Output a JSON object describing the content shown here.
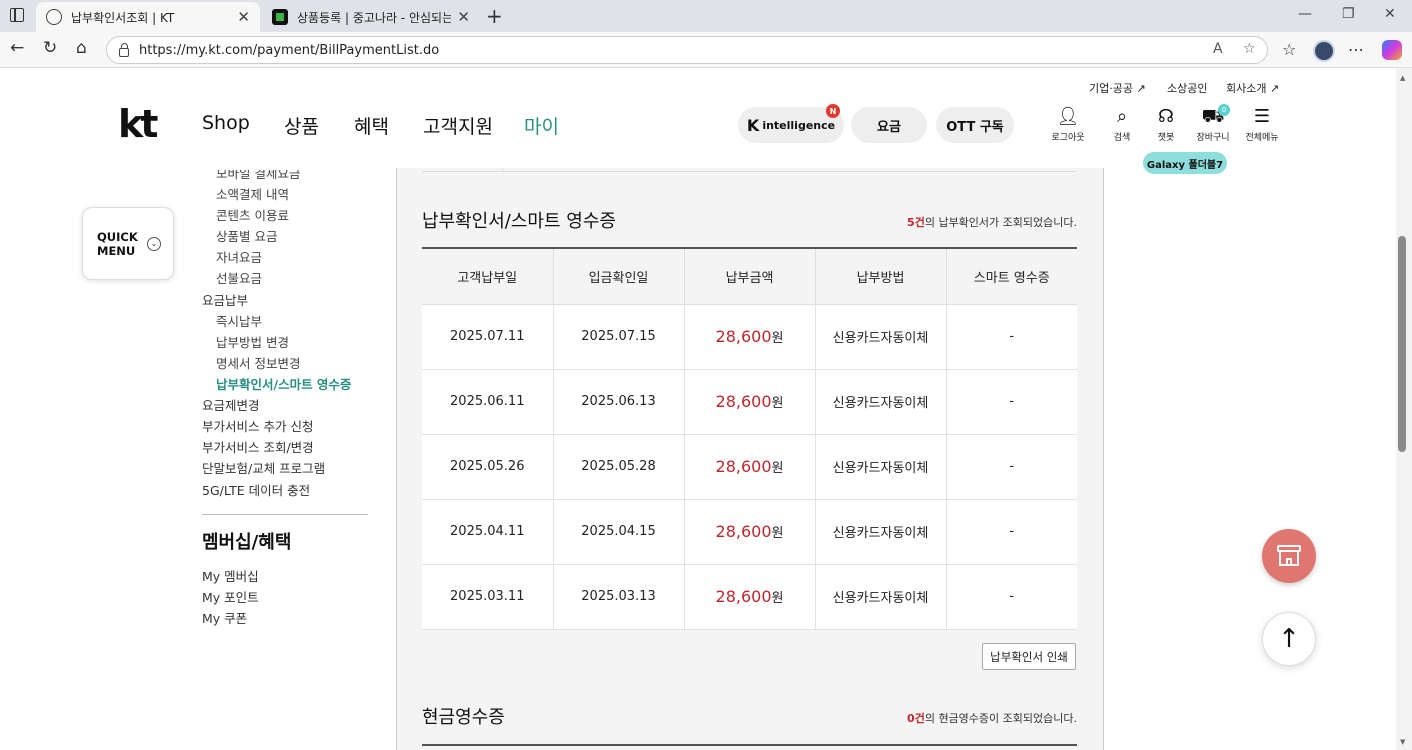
{
  "browser": {
    "tabs": [
      {
        "title": "납부확인서조회 | KT"
      },
      {
        "title": "상품등록 | 중고나라 - 안심되는 중"
      }
    ],
    "url": "https://my.kt.com/payment/BillPaymentList.do"
  },
  "header": {
    "util_links": [
      "기업·공공 ↗",
      "소상공인",
      "회사소개 ↗"
    ],
    "logo": "kt",
    "gnb": [
      "Shop",
      "상품",
      "혜택",
      "고객지원",
      "마이"
    ],
    "pills": {
      "intelligence_k": "K",
      "intelligence": "intelligence",
      "badge": "N",
      "fee": "요금",
      "ott": "OTT 구독"
    },
    "icons": [
      {
        "icon": "user-icon",
        "label": "로그아웃"
      },
      {
        "icon": "search-icon",
        "label": "검색"
      },
      {
        "icon": "headset-icon",
        "label": "챗봇"
      },
      {
        "icon": "cart-icon",
        "label": "장바구니"
      },
      {
        "icon": "menu-icon",
        "label": "전체메뉴"
      }
    ],
    "cart_count": "0",
    "promo_tag": "Galaxy 폴더블7"
  },
  "quick_menu": {
    "line1": "QUICK",
    "line2": "MENU"
  },
  "left_nav": {
    "items": [
      {
        "label": "모바일 결제요금",
        "level": "sub"
      },
      {
        "label": "소액결제 내역",
        "level": "sub"
      },
      {
        "label": "콘텐츠 이용료",
        "level": "sub"
      },
      {
        "label": "상품별 요금",
        "level": "sub"
      },
      {
        "label": "자녀요금",
        "level": "sub"
      },
      {
        "label": "선불요금",
        "level": "sub"
      },
      {
        "label": "요금납부",
        "level": "top"
      },
      {
        "label": "즉시납부",
        "level": "sub"
      },
      {
        "label": "납부방법 변경",
        "level": "sub"
      },
      {
        "label": "명세서 정보변경",
        "level": "sub"
      },
      {
        "label": "납부확인서/스마트 영수증",
        "level": "active"
      },
      {
        "label": "요금제변경",
        "level": "top"
      },
      {
        "label": "부가서비스 추가 신청",
        "level": "top"
      },
      {
        "label": "부가서비스 조회/변경",
        "level": "top"
      },
      {
        "label": "단말보험/교체 프로그램",
        "level": "top"
      },
      {
        "label": "5G/LTE 데이터 충전",
        "level": "top"
      }
    ],
    "membership_heading": "멤버십/혜택",
    "membership_items": [
      "My 멤버십",
      "My 포인트",
      "My 쿠폰"
    ]
  },
  "payment_section": {
    "title": "납부확인서/스마트 영수증",
    "count": "5건",
    "count_suffix": "의 납부확인서가 조회되었습니다.",
    "columns": [
      "고객납부일",
      "입금확인일",
      "납부금액",
      "납부방법",
      "스마트 영수증"
    ],
    "rows": [
      {
        "pay_date": "2025.07.11",
        "confirm_date": "2025.07.15",
        "amount": "28,600",
        "unit": "원",
        "method": "신용카드자동이체",
        "receipt": "-"
      },
      {
        "pay_date": "2025.06.11",
        "confirm_date": "2025.06.13",
        "amount": "28,600",
        "unit": "원",
        "method": "신용카드자동이체",
        "receipt": "-"
      },
      {
        "pay_date": "2025.05.26",
        "confirm_date": "2025.05.28",
        "amount": "28,600",
        "unit": "원",
        "method": "신용카드자동이체",
        "receipt": "-"
      },
      {
        "pay_date": "2025.04.11",
        "confirm_date": "2025.04.15",
        "amount": "28,600",
        "unit": "원",
        "method": "신용카드자동이체",
        "receipt": "-"
      },
      {
        "pay_date": "2025.03.11",
        "confirm_date": "2025.03.13",
        "amount": "28,600",
        "unit": "원",
        "method": "신용카드자동이체",
        "receipt": "-"
      }
    ],
    "print_button": "납부확인서 인쇄"
  },
  "cash_section": {
    "title": "현금영수증",
    "count": "0건",
    "count_suffix": "의 현금영수증이 조회되었습니다."
  },
  "colors": {
    "accent": "#2a8f83",
    "amount": "#c0272d",
    "store_fab": "#e07670",
    "promo": "#8fdede"
  }
}
